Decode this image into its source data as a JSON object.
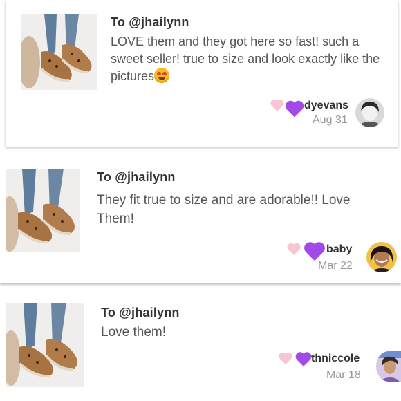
{
  "reviews": [
    {
      "to": "To @jhailynn",
      "text": "LOVE them and they got here so fast! such a sweet seller! true to size and look exactly like the pictures",
      "emoji": "star-struck-emoji",
      "username_fragment": "dyevans",
      "date": "Aug 31"
    },
    {
      "to": "To @jhailynn",
      "text": "They fit true to size and are adorable!! Love Them!",
      "username_fragment": "baby",
      "date": "Mar 22"
    },
    {
      "to": "To @jhailynn",
      "text": "Love them!",
      "username_fragment": "thniccole",
      "date": "Mar 18"
    }
  ],
  "colors": {
    "heart_pink": "#f6c6d2",
    "heart_purple": "#a24ae8",
    "date_gray": "#999999"
  },
  "icons": {
    "like": "pink-heart-icon",
    "reaction": "purple-heart-icon"
  }
}
